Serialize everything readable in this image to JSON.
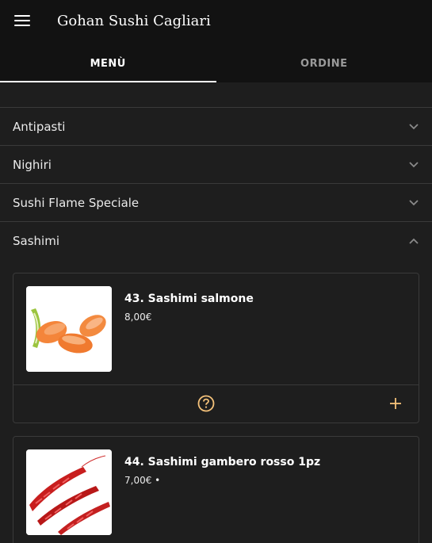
{
  "appbar": {
    "title": "Gohan Sushi Cagliari",
    "menu_icon": "hamburger-menu-icon"
  },
  "tabs": [
    {
      "label": "MENÙ",
      "active": true
    },
    {
      "label": "ORDINE",
      "active": false
    }
  ],
  "categories": [
    {
      "label": "Antipasti",
      "expanded": false
    },
    {
      "label": "Nighiri",
      "expanded": false
    },
    {
      "label": "Sushi Flame Speciale",
      "expanded": false
    },
    {
      "label": "Sashimi",
      "expanded": true
    }
  ],
  "items": [
    {
      "name": "43. Sashimi salmone",
      "price": "8,00€"
    },
    {
      "name": "44. Sashimi gambero rosso 1pz",
      "price": "7,00€ •"
    }
  ],
  "colors": {
    "accent": "#f5c27a",
    "background": "#1e1e1e",
    "appbar": "#121212",
    "divider": "#3a3a3a"
  }
}
